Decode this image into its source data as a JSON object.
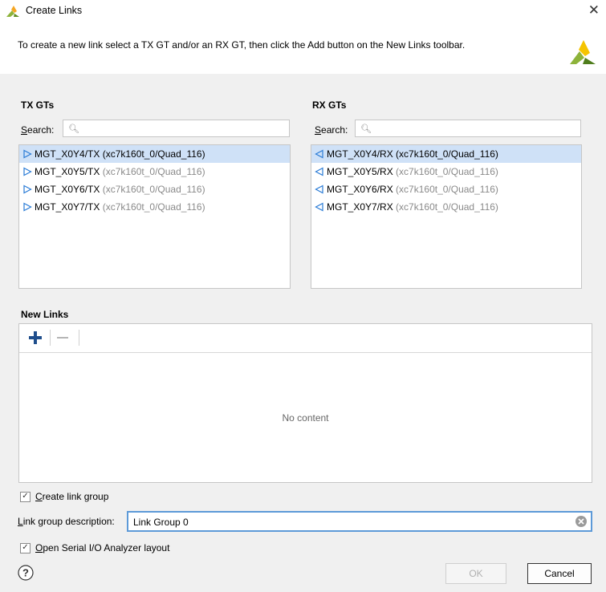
{
  "window": {
    "title": "Create Links"
  },
  "header": {
    "instruction": "To create a new link select a TX GT and/or an RX GT, then click the Add button on the New Links toolbar."
  },
  "tx": {
    "heading": "TX GTs",
    "search_label_first": "S",
    "search_label_rest": "earch:",
    "search_value": "",
    "items": [
      {
        "name": "MGT_X0Y4/TX",
        "loc": "(xc7k160t_0/Quad_116)",
        "selected": true
      },
      {
        "name": "MGT_X0Y5/TX",
        "loc": "(xc7k160t_0/Quad_116)",
        "selected": false
      },
      {
        "name": "MGT_X0Y6/TX",
        "loc": "(xc7k160t_0/Quad_116)",
        "selected": false
      },
      {
        "name": "MGT_X0Y7/TX",
        "loc": "(xc7k160t_0/Quad_116)",
        "selected": false
      }
    ]
  },
  "rx": {
    "heading": "RX GTs",
    "search_label_first": "S",
    "search_label_rest": "earch:",
    "search_value": "",
    "items": [
      {
        "name": "MGT_X0Y4/RX",
        "loc": "(xc7k160t_0/Quad_116)",
        "selected": true
      },
      {
        "name": "MGT_X0Y5/RX",
        "loc": "(xc7k160t_0/Quad_116)",
        "selected": false
      },
      {
        "name": "MGT_X0Y6/RX",
        "loc": "(xc7k160t_0/Quad_116)",
        "selected": false
      },
      {
        "name": "MGT_X0Y7/RX",
        "loc": "(xc7k160t_0/Quad_116)",
        "selected": false
      }
    ]
  },
  "new_links": {
    "heading": "New Links",
    "empty_text": "No content",
    "add_icon": "plus-icon",
    "remove_icon": "minus-icon"
  },
  "options": {
    "create_group": {
      "label_first": "C",
      "label_rest": "reate link group",
      "checked": true
    },
    "description_label_first": "L",
    "description_label_rest": "ink group description:",
    "description_value": "Link Group 0",
    "open_layout": {
      "label_first": "O",
      "label_rest": "pen Serial I/O Analyzer layout",
      "checked": true
    }
  },
  "buttons": {
    "ok": "OK",
    "cancel": "Cancel",
    "help": "?"
  },
  "colors": {
    "accent": "#5d9ad8",
    "selection": "#cfe1f7",
    "plus": "#1f4e8c"
  }
}
